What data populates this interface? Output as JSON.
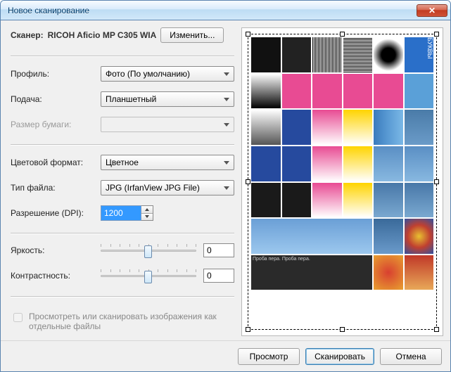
{
  "window": {
    "title": "Новое сканирование"
  },
  "scanner": {
    "label": "Сканер:",
    "name": "RICOH Aficio MP C305 WIA",
    "change_btn": "Изменить..."
  },
  "profile": {
    "label": "Профиль:",
    "value": "Фото (По умолчанию)"
  },
  "source": {
    "label": "Подача:",
    "value": "Планшетный"
  },
  "paper_size": {
    "label": "Размер бумаги:",
    "value": ""
  },
  "color_format": {
    "label": "Цветовой формат:",
    "value": "Цветное"
  },
  "file_type": {
    "label": "Тип файла:",
    "value": "JPG (IrfanView JPG File)"
  },
  "resolution": {
    "label": "Разрешение (DPI):",
    "value": "1200"
  },
  "brightness": {
    "label": "Яркость:",
    "value": "0"
  },
  "contrast": {
    "label": "Контрастность:",
    "value": "0"
  },
  "checkbox": {
    "label": "Просмотреть или сканировать изображения как отдельные файлы"
  },
  "footer": {
    "preview": "Просмотр",
    "scan": "Сканировать",
    "cancel": "Отмена"
  }
}
